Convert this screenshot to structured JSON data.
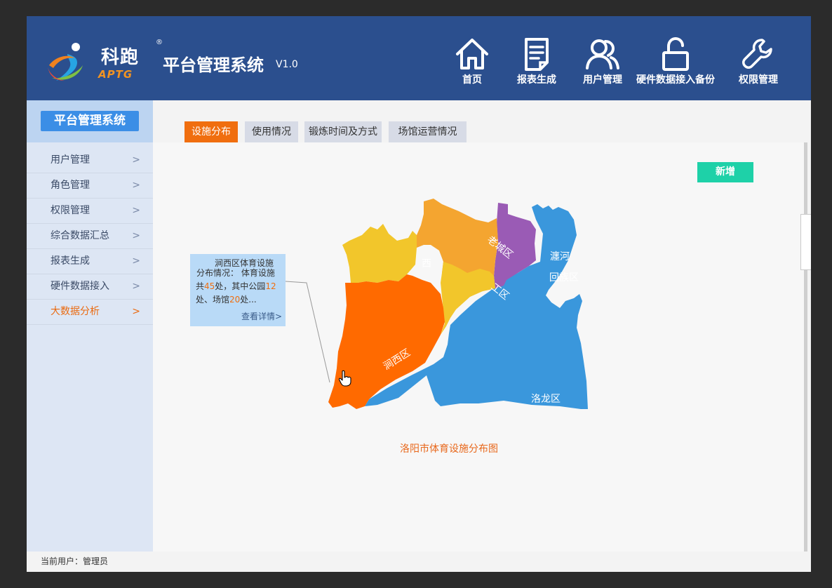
{
  "brand": {
    "name_cn": "科跑",
    "name_en": "APTG",
    "reg_mark": "®"
  },
  "header": {
    "title": "平台管理系统",
    "version": "V1.0"
  },
  "nav": [
    {
      "label": "首页",
      "icon": "home-icon"
    },
    {
      "label": "报表生成",
      "icon": "report-icon"
    },
    {
      "label": "用户管理",
      "icon": "users-icon"
    },
    {
      "label": "硬件数据接入备份",
      "icon": "unlock-icon"
    },
    {
      "label": "权限管理",
      "icon": "wrench-icon"
    }
  ],
  "sidebar": {
    "title": "平台管理系统",
    "items": [
      {
        "label": "用户管理"
      },
      {
        "label": "角色管理"
      },
      {
        "label": "权限管理"
      },
      {
        "label": "综合数据汇总"
      },
      {
        "label": "报表生成"
      },
      {
        "label": "硬件数据接入"
      },
      {
        "label": "大数据分析",
        "active": true
      }
    ],
    "chevron": ">"
  },
  "tabs": [
    {
      "label": "设施分布",
      "active": true
    },
    {
      "label": "使用情况"
    },
    {
      "label": "锻炼时间及方式"
    },
    {
      "label": "场馆运营情况"
    }
  ],
  "actions": {
    "add_label": "新增"
  },
  "map": {
    "caption": "洛阳市体育设施分布图",
    "regions": {
      "xigong": "西",
      "laocheng": "老城区",
      "chanhe": "瀍河",
      "huizu": "回族区",
      "gong": "工区",
      "jianxi": "涧西区",
      "luolong": "洛龙区"
    },
    "colors": {
      "xigong": "#f2c62b",
      "laocheng": "#f4a530",
      "chanhe": "#9a5bb5",
      "gong": "#f2c62b",
      "jianxi": "#ff6a00",
      "luolong": "#3a97dc"
    }
  },
  "tooltip": {
    "title": "涧西区体育设施",
    "line2": "分布情况： 体育设施",
    "line3_pre": "共",
    "total": "45",
    "line3_mid": "处，其中公园",
    "parks": "12",
    "line4_pre": "处、场馆",
    "venues": "20",
    "line4_post": "处...",
    "more": "查看详情>"
  },
  "footer": {
    "current_user": "当前用户：管理员"
  }
}
